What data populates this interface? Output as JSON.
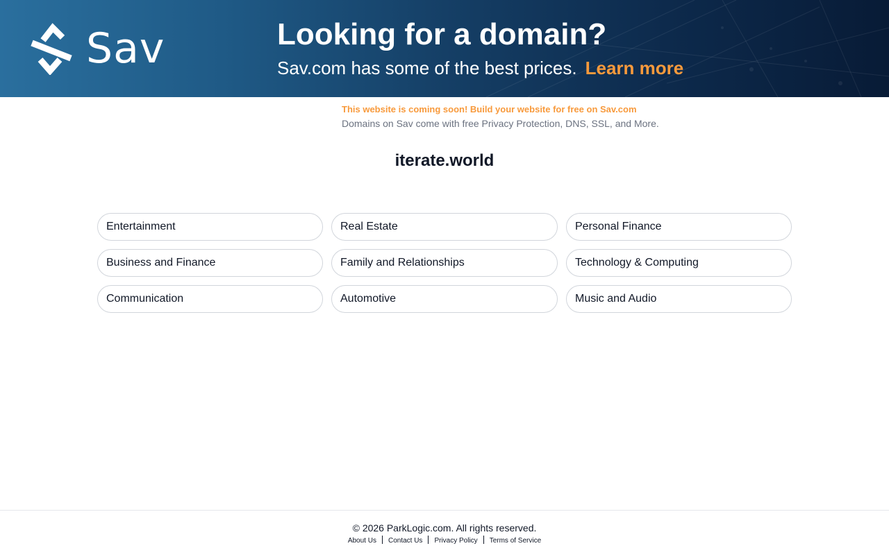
{
  "banner": {
    "logo_text": "Sav",
    "headline": "Looking for a domain?",
    "subline": "Sav.com has some of the best prices.",
    "cta": "Learn more",
    "colors": {
      "accent": "#f89a3c",
      "bg_dark": "#081b36",
      "bg_light": "#2a6f9e"
    }
  },
  "notice": {
    "promo": "This website is coming soon! Build your website for free on Sav.com",
    "sub": "Domains on Sav come with free Privacy Protection, DNS, SSL, and More."
  },
  "domain": "iterate.world",
  "categories": [
    "Entertainment",
    "Real Estate",
    "Personal Finance",
    "Business and Finance",
    "Family and Relationships",
    "Technology & Computing",
    "Communication",
    "Automotive",
    "Music and Audio"
  ],
  "footer": {
    "copyright": "© 2026 ParkLogic.com. All rights reserved.",
    "links": [
      "About Us",
      "Contact Us",
      "Privacy Policy",
      "Terms of Service"
    ]
  }
}
